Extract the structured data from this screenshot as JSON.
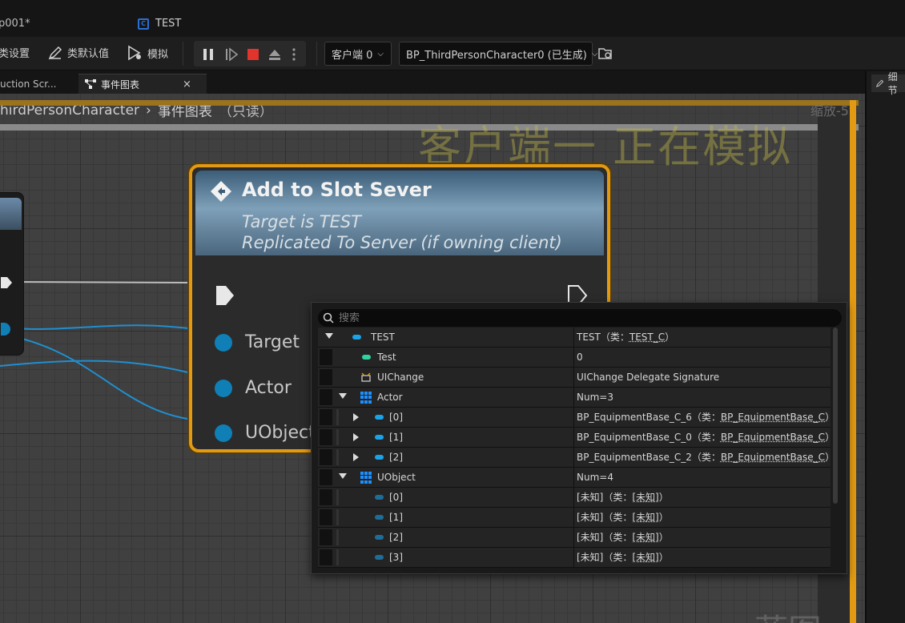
{
  "window": {
    "left_tab_partial": "p001*",
    "asset_tab": "TEST"
  },
  "toolbar": {
    "class_settings": "类设置",
    "class_defaults": "类默认值",
    "simulate": "模拟",
    "client_dropdown": "客户端 0",
    "debug_object": "BP_ThirdPersonCharacter0 (已生成)"
  },
  "tabs": {
    "construction_partial": "uction Scr...",
    "event_graph": "事件图表",
    "close_symbol": "×",
    "details": "细节"
  },
  "graph": {
    "breadcrumb_root": "hirdPersonCharacter",
    "breadcrumb_graph": "事件图表",
    "breadcrumb_readonly": "（只读）",
    "zoom_label": "缩放-5",
    "sim_watermark": "客户端一 正在模拟",
    "bottom_watermark": "蓝图"
  },
  "node": {
    "title": "Add to Slot Sever",
    "subtitle_1": "Target is TEST",
    "subtitle_2": "Replicated To Server (if owning client)",
    "pins": [
      "Target",
      "Actor",
      "UObject"
    ]
  },
  "debug_panel": {
    "search_placeholder": "搜索",
    "rows": [
      {
        "name": "TEST",
        "value": "TEST（类：",
        "link": "TEST_C",
        "suffix": "）"
      },
      {
        "name": "Test",
        "value": "0"
      },
      {
        "name": "UIChange",
        "value": "UIChange  Delegate Signature"
      },
      {
        "name": "Actor",
        "value": "Num=3"
      },
      {
        "name": "[0]",
        "value": "BP_EquipmentBase_C_6（类：",
        "link": "BP_EquipmentBase_C",
        "suffix": "）"
      },
      {
        "name": "[1]",
        "value": "BP_EquipmentBase_C_0（类：",
        "link": "BP_EquipmentBase_C",
        "suffix": "）"
      },
      {
        "name": "[2]",
        "value": "BP_EquipmentBase_C_2（类：",
        "link": "BP_EquipmentBase_C",
        "suffix": "）"
      },
      {
        "name": "UObject",
        "value": "Num=4"
      },
      {
        "name": "[0]",
        "value": "[未知]（类：",
        "link": "[未知]",
        "suffix": "）"
      },
      {
        "name": "[1]",
        "value": "[未知]（类：",
        "link": "[未知]",
        "suffix": "）"
      },
      {
        "name": "[2]",
        "value": "[未知]（类：",
        "link": "[未知]",
        "suffix": "）"
      },
      {
        "name": "[3]",
        "value": "[未知]（类：",
        "link": "[未知]",
        "suffix": "）"
      }
    ]
  },
  "colors": {
    "simulation_border": "#e29a12",
    "object_pin": "#0f7fb6",
    "node_header": "#7fa0b9"
  }
}
